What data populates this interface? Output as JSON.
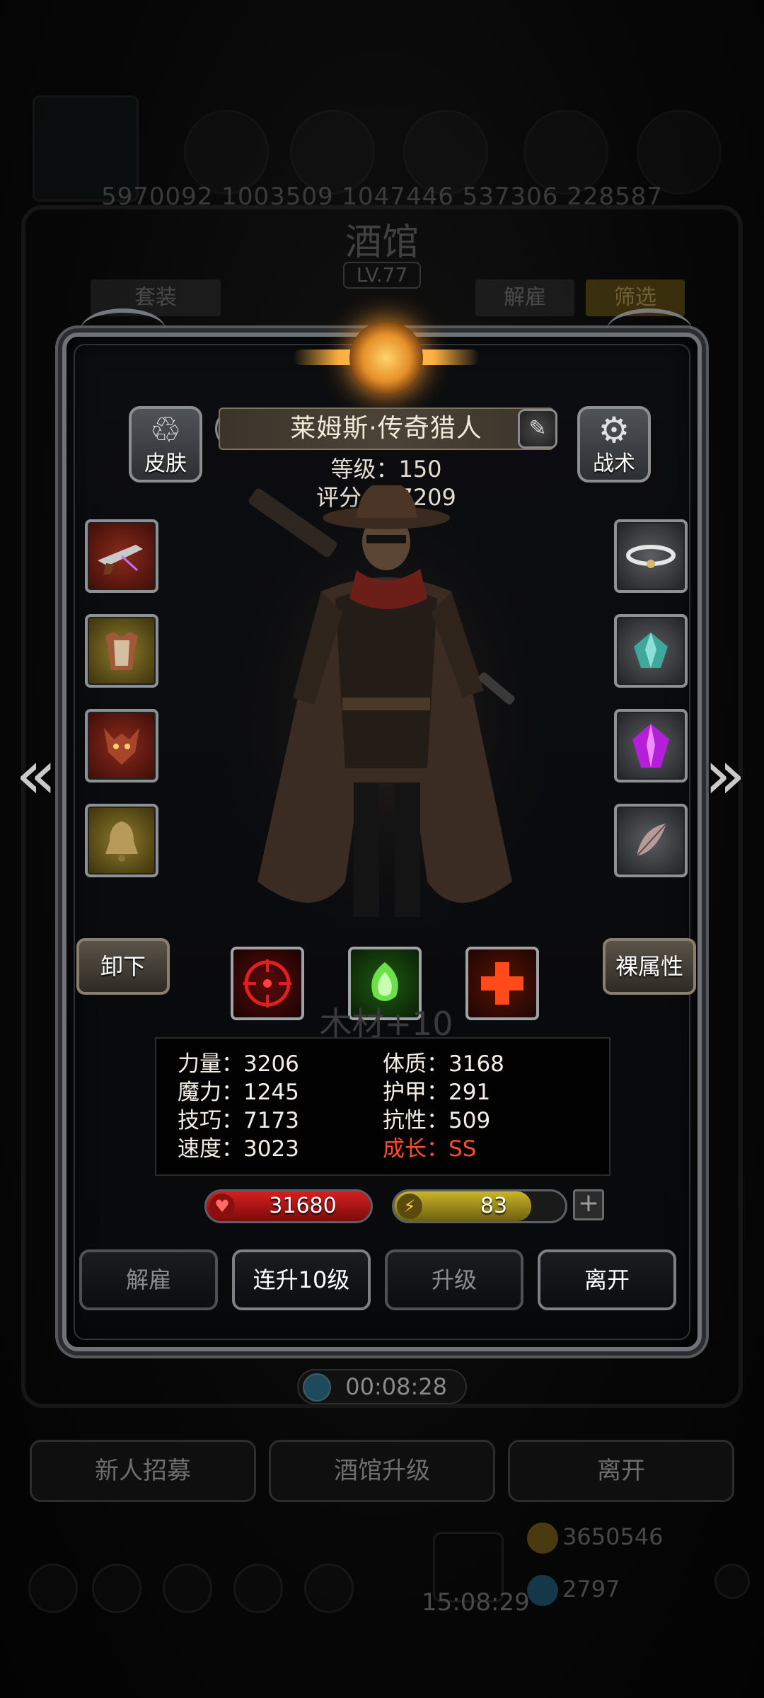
{
  "background": {
    "id_strip": "5970092 1003509 1047446 537306 228587",
    "title": "酒馆",
    "level_badge": "LV.77",
    "tabs": {
      "set": "套装",
      "dismiss": "解雇",
      "filter": "筛选"
    },
    "timer": "00:08:28",
    "buttons": {
      "recruit": "新人招募",
      "upgrade_tavern": "酒馆升级",
      "leave": "离开"
    },
    "clock": "15:08:29",
    "gold": "3650546",
    "gems": "2797"
  },
  "hero": {
    "name": "莱姆斯·传奇猎人",
    "level_label": "等级：150",
    "score_label": "评分：27209",
    "skin_label": "皮肤",
    "tactics_label": "战术",
    "unequip_label": "卸下",
    "base_attr_label": "裸属性",
    "watermark": "木材+10"
  },
  "equipment_left": [
    {
      "name": "pistol-icon",
      "tier": "red"
    },
    {
      "name": "armor-icon",
      "tier": "gold"
    },
    {
      "name": "demon-mask-icon",
      "tier": "red"
    },
    {
      "name": "bell-icon",
      "tier": "gold"
    }
  ],
  "equipment_right": [
    {
      "name": "halo-ring-icon",
      "tier": "grey"
    },
    {
      "name": "crystal-icon",
      "tier": "grey"
    },
    {
      "name": "purple-gem-icon",
      "tier": "grey"
    },
    {
      "name": "feather-icon",
      "tier": "grey"
    }
  ],
  "skills": [
    {
      "name": "crosshair-skill-icon",
      "color": "#c81a1a"
    },
    {
      "name": "green-wisp-skill-icon",
      "color": "#4cc23b"
    },
    {
      "name": "red-cross-skill-icon",
      "color": "#e23a1a"
    }
  ],
  "attributes": {
    "strength": "力量：3206",
    "constitution": "体质：3168",
    "magic": "魔力：1245",
    "armor": "护甲：291",
    "skill": "技巧：7173",
    "resistance": "抗性：509",
    "speed": "速度：3023",
    "growth": "成长：SS"
  },
  "resources": {
    "hp": "31680",
    "energy": "83",
    "energy_fill": 0.8,
    "hp_color": "#d61f1f",
    "energy_color": "#c9b627"
  },
  "actions": {
    "dismiss": "解雇",
    "level_up_10": "连升10级",
    "upgrade": "升级",
    "leave": "离开"
  }
}
